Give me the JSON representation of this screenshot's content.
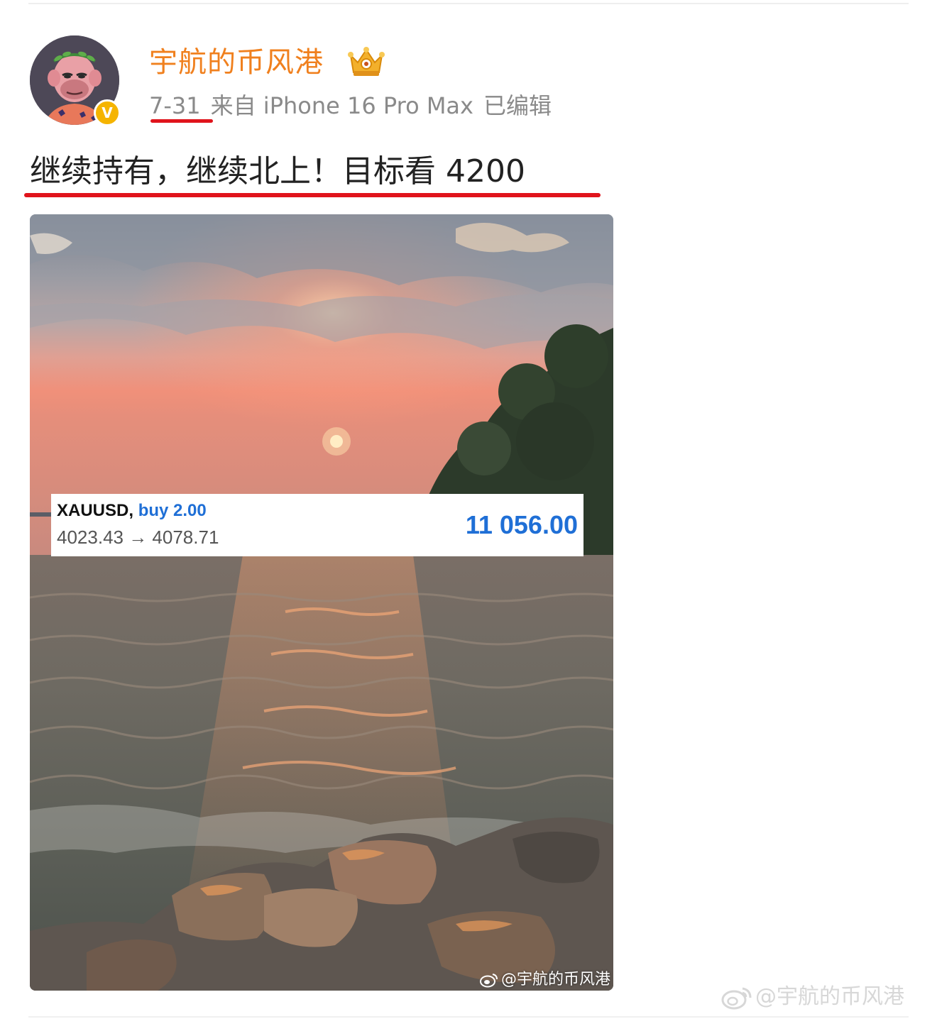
{
  "post": {
    "username": "宇航的币风港",
    "verified_badge": "V",
    "crown_icon": "crown-icon",
    "date": "7-31",
    "source": "来自 iPhone 16 Pro Max",
    "edited": "已编辑",
    "text": "继续持有，继续北上！目标看 4200",
    "underline_color": "#e0141c",
    "username_color": "#f0801e"
  },
  "trade_card": {
    "symbol": "XAUUSD,",
    "side": "buy 2.00",
    "prices": "4023.43 → 4078.71",
    "profit": "11 056.00",
    "accent_color": "#1f6fd6"
  },
  "watermarks": {
    "image": "@宇航的币风港",
    "page": "@宇航的币风港"
  }
}
